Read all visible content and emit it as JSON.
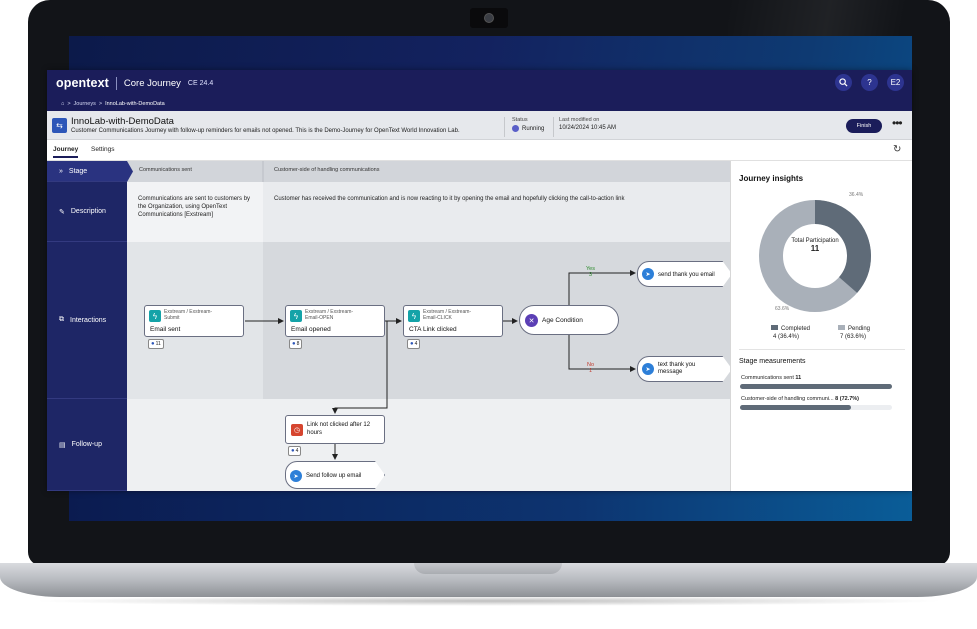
{
  "header": {
    "brand": "opentext",
    "product": "Core Journey",
    "version": "CE 24.4",
    "search_icon": "search-icon",
    "help_label": "?",
    "user_initials": "E2"
  },
  "breadcrumb": {
    "home_icon": "home-icon",
    "sep": ">",
    "items": [
      "Journeys",
      "InnoLab-with-DemoData"
    ]
  },
  "journey": {
    "title": "InnoLab-with-DemoData",
    "description": "Customer Communications Journey with follow-up reminders for emails not opened. This is the Demo-Journey for OpenText World Innovation Lab.",
    "status_label": "Status",
    "status_value": "Running",
    "modified_label": "Last modified on",
    "modified_value": "10/24/2024 10:45 AM",
    "finish_label": "Finish",
    "more_label": "•••"
  },
  "tabs": {
    "journey": "Journey",
    "settings": "Settings",
    "refresh_icon": "refresh-icon"
  },
  "rows": {
    "stage": "Stage",
    "description": "Description",
    "interactions": "Interactions",
    "followup": "Follow-up"
  },
  "stages": [
    {
      "name": "Communications sent",
      "description": "Communications are sent to customers by the Organization, using OpenText Communications [Exstream]"
    },
    {
      "name": "Customer-side of handling communications",
      "description": "Customer has received the communication and is now reacting to it by opening the email and hopefully clicking the call-to-action link"
    }
  ],
  "nodes": {
    "email_sent": {
      "source": "Exstream / Exstream-Submit",
      "label": "Email sent",
      "count": "11"
    },
    "email_opened": {
      "source": "Exstream / Exstream-Email-OPEN",
      "label": "Email opened",
      "count": "8"
    },
    "cta_clicked": {
      "source": "Exstream / Exstream-Email-CLICK",
      "label": "CTA Link clicked",
      "count": "4"
    },
    "condition": {
      "label": "Age Condition"
    },
    "yes_branch": {
      "label": "Yes",
      "count": "3",
      "action": "send thank you email"
    },
    "no_branch": {
      "label": "No",
      "count": "1",
      "action": "text thank you message"
    },
    "wait": {
      "label": "Link not clicked after 12 hours",
      "count": "4"
    },
    "followup_action": {
      "label": "Send follow up email"
    }
  },
  "insights": {
    "title": "Journey insights",
    "total_label": "Total Participation",
    "total_value": "11",
    "completed_pct_label": "36.4%",
    "pending_pct_label": "63.6%",
    "completed_label": "Completed",
    "completed_value": "4 (36.4%)",
    "pending_label": "Pending",
    "pending_value": "7 (63.6%)",
    "completed_fraction": 0.364,
    "colors": {
      "completed": "#5f6b78",
      "pending": "#a9b0b9"
    },
    "stage_title": "Stage measurements",
    "stage_bars": [
      {
        "label": "Communications sent",
        "value": "11",
        "fraction": 1.0
      },
      {
        "label": "Customer-side of handling communi...",
        "value": "8 (72.7%)",
        "fraction": 0.727
      }
    ]
  }
}
